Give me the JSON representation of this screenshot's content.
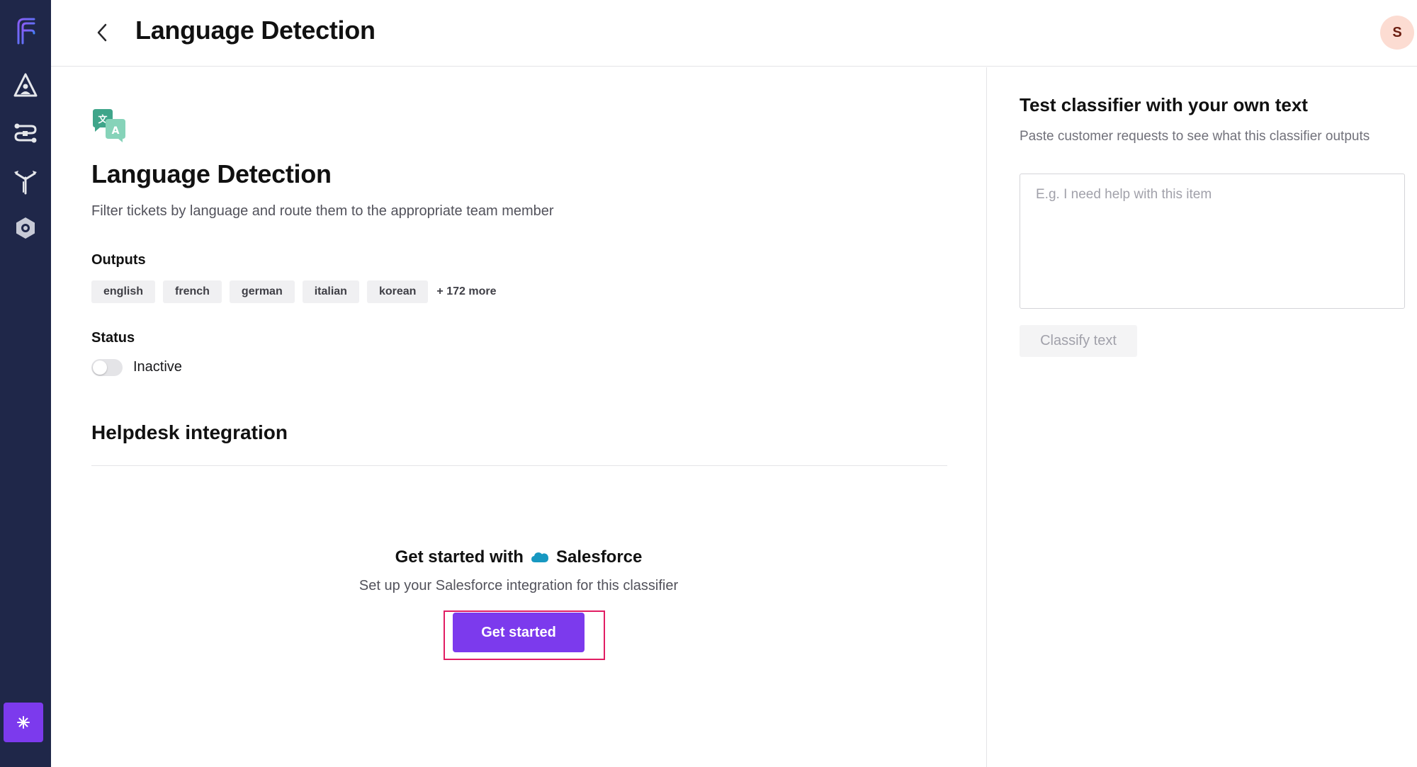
{
  "app": {
    "logo_icon": "f-logo-icon",
    "accent_color": "#7c3aed",
    "sidebar_bg": "#1f2749"
  },
  "sidebar": {
    "items": [
      {
        "icon": "agent-icon"
      },
      {
        "icon": "workflow-icon"
      },
      {
        "icon": "routing-icon"
      },
      {
        "icon": "settings-icon"
      }
    ],
    "bottom_button_icon": "sparkle-icon"
  },
  "header": {
    "back_icon": "chevron-left-icon",
    "title": "Language Detection",
    "avatar_initial": "S"
  },
  "main": {
    "icon": "translate-icon",
    "title": "Language Detection",
    "description": "Filter tickets by language and route them to the appropriate team member",
    "outputs": {
      "label": "Outputs",
      "chips": [
        "english",
        "french",
        "german",
        "italian",
        "korean"
      ],
      "more": "+ 172 more"
    },
    "status": {
      "label": "Status",
      "value": "Inactive",
      "active": false
    },
    "integration": {
      "title": "Helpdesk integration",
      "heading_prefix": "Get started with",
      "provider": "Salesforce",
      "provider_icon": "salesforce-cloud-icon",
      "subtitle": "Set up your Salesforce integration for this classifier",
      "button_label": "Get started"
    }
  },
  "test_panel": {
    "title": "Test classifier with your own text",
    "subtitle": "Paste customer requests to see what this classifier outputs",
    "input_placeholder": "E.g. I need help with this item",
    "input_value": "",
    "button_label": "Classify text"
  }
}
